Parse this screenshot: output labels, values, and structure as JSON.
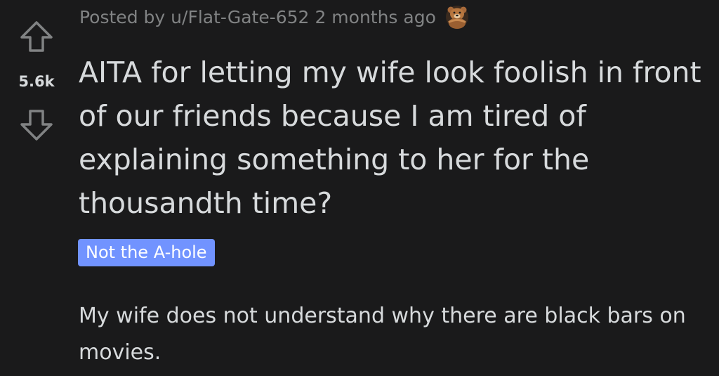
{
  "vote": {
    "score": "5.6k",
    "upvote_icon": "arrow-up-outline-icon",
    "downvote_icon": "arrow-down-outline-icon"
  },
  "post": {
    "posted_by_prefix": "Posted by",
    "author": "u/Flat-Gate-652",
    "time": "2 months ago",
    "award_icon": "bear-award-icon",
    "title": "AITA for letting my wife look foolish in front of our friends because I am tired of explaining something to her for the thousandth time?",
    "flair": "Not the A-hole",
    "body": "My wife does not understand why there are black bars on movies."
  },
  "colors": {
    "background": "#1a1a1b",
    "text": "#d7dadc",
    "meta": "#818384",
    "flair_bg": "#7193ff",
    "flair_text": "#ffffff"
  }
}
